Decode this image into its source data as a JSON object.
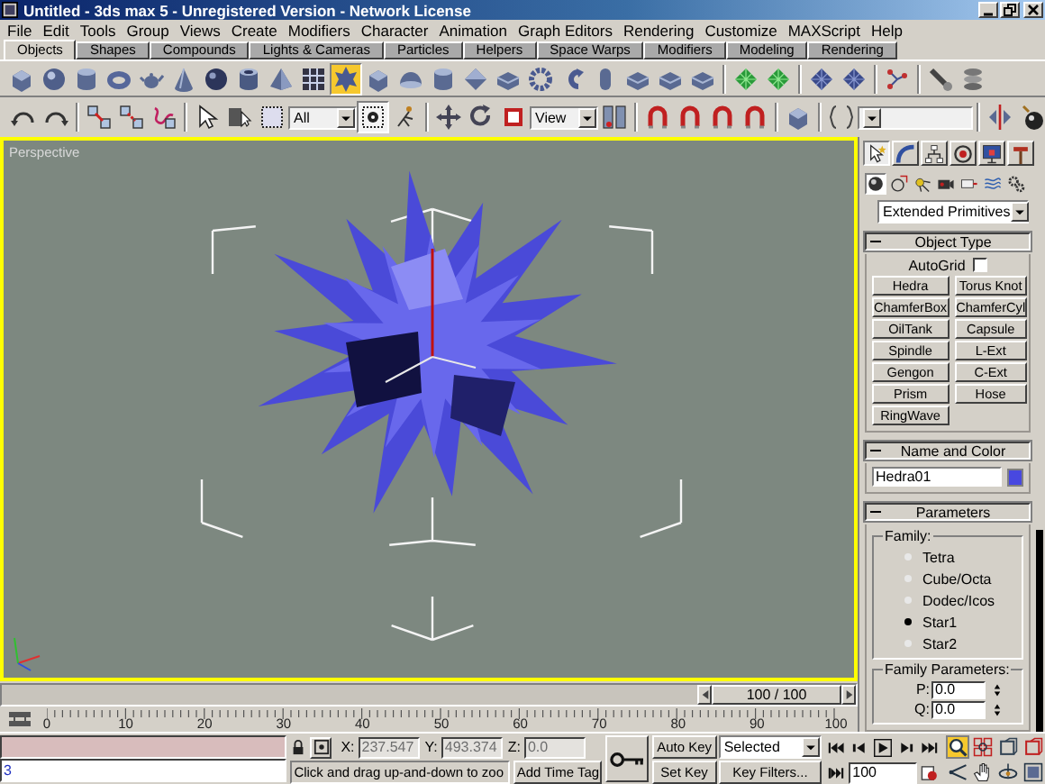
{
  "window": {
    "title": "Untitled - 3ds max 5 - Unregistered Version - Network License"
  },
  "menu": [
    "File",
    "Edit",
    "Tools",
    "Group",
    "Views",
    "Create",
    "Modifiers",
    "Character",
    "Animation",
    "Graph Editors",
    "Rendering",
    "Customize",
    "MAXScript",
    "Help"
  ],
  "tabs": [
    {
      "label": "Objects",
      "selected": true
    },
    {
      "label": "Shapes",
      "selected": false
    },
    {
      "label": "Compounds",
      "selected": false
    },
    {
      "label": "Lights & Cameras",
      "selected": false
    },
    {
      "label": "Particles",
      "selected": false
    },
    {
      "label": "Helpers",
      "selected": false
    },
    {
      "label": "Space Warps",
      "selected": false
    },
    {
      "label": "Modifiers",
      "selected": false
    },
    {
      "label": "Modeling",
      "selected": false
    },
    {
      "label": "Rendering",
      "selected": false
    }
  ],
  "create_toolbar": [
    {
      "kind": "box",
      "selected": false
    },
    {
      "kind": "sphere",
      "selected": false
    },
    {
      "kind": "cylinder",
      "selected": false
    },
    {
      "kind": "torus",
      "selected": false
    },
    {
      "kind": "teapot",
      "selected": false
    },
    {
      "kind": "cone",
      "selected": false
    },
    {
      "kind": "geosphere",
      "selected": false
    },
    {
      "kind": "tube",
      "selected": false
    },
    {
      "kind": "pyramid",
      "selected": false
    },
    {
      "kind": "grid",
      "selected": false
    },
    {
      "kind": "star",
      "selected": true
    },
    {
      "kind": "box",
      "selected": false
    },
    {
      "kind": "dome",
      "selected": false
    },
    {
      "kind": "cylinder",
      "selected": false
    },
    {
      "kind": "diamond",
      "selected": false
    },
    {
      "kind": "wedge",
      "selected": false
    },
    {
      "kind": "gear",
      "selected": false
    },
    {
      "kind": "hook",
      "selected": false
    },
    {
      "kind": "capsule",
      "selected": false
    },
    {
      "kind": "wedge",
      "selected": false
    },
    {
      "kind": "wedge",
      "selected": false
    },
    {
      "kind": "wedge",
      "selected": false
    },
    {
      "kind": "sep"
    },
    {
      "kind": "patch",
      "selected": false
    },
    {
      "kind": "patch",
      "selected": false
    },
    {
      "kind": "sep"
    },
    {
      "kind": "nurbs",
      "selected": false
    },
    {
      "kind": "nurbs",
      "selected": false
    },
    {
      "kind": "sep"
    },
    {
      "kind": "connect",
      "selected": false
    },
    {
      "kind": "sep"
    },
    {
      "kind": "wrench",
      "selected": false
    },
    {
      "kind": "stack",
      "selected": false
    }
  ],
  "main_toolbar": [
    {
      "kind": "undo",
      "selected": false
    },
    {
      "kind": "redo",
      "selected": false
    },
    {
      "kind": "sep"
    },
    {
      "kind": "link",
      "selected": false
    },
    {
      "kind": "unlink",
      "selected": false
    },
    {
      "kind": "bind",
      "selected": false
    },
    {
      "kind": "sep"
    },
    {
      "kind": "cursor",
      "selected": false
    },
    {
      "kind": "list",
      "selected": false
    },
    {
      "kind": "region",
      "selected": false
    },
    {
      "kind": "dropdown",
      "value": "All"
    },
    {
      "kind": "center",
      "selected": true
    },
    {
      "kind": "figure",
      "selected": false
    },
    {
      "kind": "sep"
    },
    {
      "kind": "move",
      "selected": false
    },
    {
      "kind": "rotate",
      "selected": false
    },
    {
      "kind": "scale",
      "selected": false
    },
    {
      "kind": "dropdown",
      "value": "View"
    },
    {
      "kind": "pivot",
      "selected": false
    },
    {
      "kind": "sep"
    },
    {
      "kind": "magnet",
      "selected": false
    },
    {
      "kind": "magnet",
      "selected": false
    },
    {
      "kind": "magnet",
      "selected": false
    },
    {
      "kind": "magnet",
      "selected": false
    },
    {
      "kind": "sep"
    },
    {
      "kind": "box",
      "selected": false
    },
    {
      "kind": "sep"
    },
    {
      "kind": "abc",
      "selected": false
    },
    {
      "kind": "wide_dropdown"
    },
    {
      "kind": "sep"
    },
    {
      "kind": "mirror",
      "selected": false
    },
    {
      "kind": "align",
      "selected": false
    }
  ],
  "viewport": {
    "label": "Perspective"
  },
  "time_slider": {
    "label": "100 / 100",
    "level": 1
  },
  "ruler": {
    "labels": [
      "0",
      "10",
      "20",
      "30",
      "40",
      "50",
      "60",
      "70",
      "80",
      "90",
      "100"
    ]
  },
  "command_panel": {
    "tabs": [
      {
        "kind": "create",
        "selected": true
      },
      {
        "kind": "modify",
        "selected": false
      },
      {
        "kind": "hierarchy",
        "selected": false
      },
      {
        "kind": "motion",
        "selected": false
      },
      {
        "kind": "display",
        "selected": false
      },
      {
        "kind": "utilities",
        "selected": false
      }
    ],
    "categories": [
      {
        "kind": "geometry",
        "selected": true
      },
      {
        "kind": "shapes",
        "selected": false
      },
      {
        "kind": "lights",
        "selected": false
      },
      {
        "kind": "cameras",
        "selected": false
      },
      {
        "kind": "helpers",
        "selected": false
      },
      {
        "kind": "spacewarps",
        "selected": false
      },
      {
        "kind": "systems",
        "selected": false
      }
    ],
    "dropdown": "Extended Primitives",
    "rollouts": [
      {
        "kind": "object_type",
        "title": "Object Type",
        "expanded": true,
        "autogrid": {
          "label": "AutoGrid",
          "checked": false
        },
        "buttons": [
          "Hedra",
          "Torus Knot",
          "ChamferBox",
          "ChamferCyl",
          "OilTank",
          "Capsule",
          "Spindle",
          "L-Ext",
          "Gengon",
          "C-Ext",
          "Prism",
          "Hose",
          "RingWave"
        ]
      },
      {
        "kind": "name_color",
        "title": "Name and Color",
        "expanded": true,
        "name": "Hedra01",
        "color": "#4848e0"
      },
      {
        "kind": "parameters",
        "title": "Parameters",
        "expanded": true,
        "groups": [
          {
            "kind": "radios",
            "title": "Family:",
            "options": [
              {
                "label": "Tetra",
                "selected": false
              },
              {
                "label": "Cube/Octa",
                "selected": false
              },
              {
                "label": "Dodec/Icos",
                "selected": false
              },
              {
                "label": "Star1",
                "selected": true
              },
              {
                "label": "Star2",
                "selected": false
              }
            ]
          },
          {
            "kind": "spinners",
            "title": "Family Parameters:",
            "fields": [
              {
                "label": "P:",
                "value": "0.0"
              },
              {
                "label": "Q:",
                "value": "0.0"
              }
            ]
          }
        ]
      }
    ]
  },
  "listener": {
    "input": "3"
  },
  "coordinates": [
    {
      "label": "X:",
      "value": "237.547",
      "disabled": true
    },
    {
      "label": "Y:",
      "value": "493.374",
      "disabled": true
    },
    {
      "label": "Z:",
      "value": "0.0",
      "disabled": true
    }
  ],
  "status": {
    "prompt": "Click and drag up-and-down to zoo",
    "time_tag": "Add Time Tag"
  },
  "animation": {
    "auto_key": "Auto Key",
    "selection": "Selected",
    "set_key": "Set Key",
    "key_filters": "Key Filters..."
  },
  "playback": [
    {
      "kind": "gostart"
    },
    {
      "kind": "prev"
    },
    {
      "kind": "play"
    },
    {
      "kind": "next"
    },
    {
      "kind": "goend"
    }
  ],
  "frame": "100",
  "nav": [
    {
      "kind": "zoom",
      "selected": true
    },
    {
      "kind": "zoomall",
      "selected": false
    },
    {
      "kind": "extents",
      "selected": false
    },
    {
      "kind": "extentsall",
      "selected": false
    },
    {
      "kind": "fov",
      "selected": false
    },
    {
      "kind": "pan",
      "selected": false
    },
    {
      "kind": "orbit",
      "selected": false
    },
    {
      "kind": "maximize",
      "selected": false
    }
  ]
}
